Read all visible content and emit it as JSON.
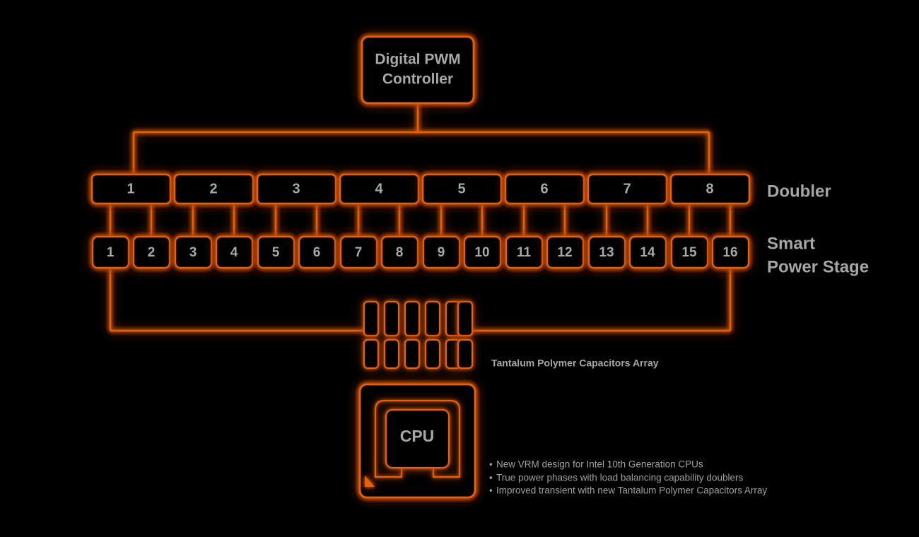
{
  "theme": {
    "background": "#000000",
    "accent": "#e8600f",
    "accent_glow": "#ff7a1f",
    "box_fill": "#060606",
    "text": "#a8a8a8"
  },
  "controller": {
    "name": "digital-pwm-controller",
    "line1": "Digital PWM",
    "line2": "Controller"
  },
  "doubler": {
    "row_label": "Doubler",
    "items": [
      {
        "label": "1"
      },
      {
        "label": "2"
      },
      {
        "label": "3"
      },
      {
        "label": "4"
      },
      {
        "label": "5"
      },
      {
        "label": "6"
      },
      {
        "label": "7"
      },
      {
        "label": "8"
      }
    ]
  },
  "power_stage": {
    "row_label_line1": "Smart",
    "row_label_line2": "Power Stage",
    "items": [
      {
        "label": "1"
      },
      {
        "label": "2"
      },
      {
        "label": "3"
      },
      {
        "label": "4"
      },
      {
        "label": "5"
      },
      {
        "label": "6"
      },
      {
        "label": "7"
      },
      {
        "label": "8"
      },
      {
        "label": "9"
      },
      {
        "label": "10"
      },
      {
        "label": "11"
      },
      {
        "label": "12"
      },
      {
        "label": "13"
      },
      {
        "label": "14"
      },
      {
        "label": "15"
      },
      {
        "label": "16"
      }
    ]
  },
  "capacitors": {
    "label": "Tantalum Polymer Capacitors Array",
    "rows": 2,
    "per_row": 6
  },
  "cpu": {
    "label": "CPU",
    "socket_marker": "orientation-triangle"
  },
  "features": {
    "bullet_char": "•",
    "items": [
      "New VRM design for Intel 10th Generation CPUs",
      "True power phases with load balancing capability doublers",
      "Improved transient with new Tantalum Polymer Capacitors Array"
    ]
  }
}
